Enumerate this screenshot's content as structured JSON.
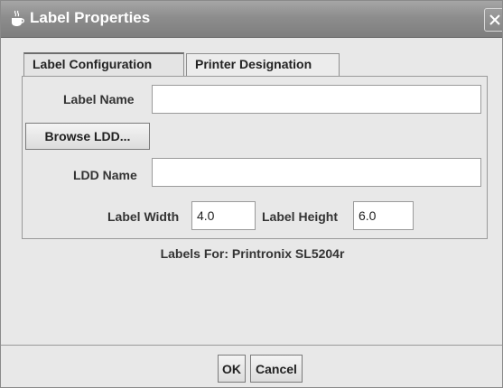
{
  "window": {
    "title": "Label Properties",
    "close_glyph": "✕"
  },
  "tabs": [
    {
      "label": "Label Configuration",
      "selected": true
    },
    {
      "label": "Printer Designation",
      "selected": false
    }
  ],
  "form": {
    "label_name": {
      "label": "Label Name",
      "value": ""
    },
    "browse_button": "Browse LDD...",
    "ldd_name": {
      "label": "LDD Name",
      "value": ""
    },
    "label_width": {
      "label": "Label Width",
      "value": "4.0"
    },
    "label_height": {
      "label": "Label Height",
      "value": "6.0"
    }
  },
  "info_text": "Labels For: Printronix SL5204r",
  "buttons": {
    "ok": "OK",
    "cancel": "Cancel"
  }
}
